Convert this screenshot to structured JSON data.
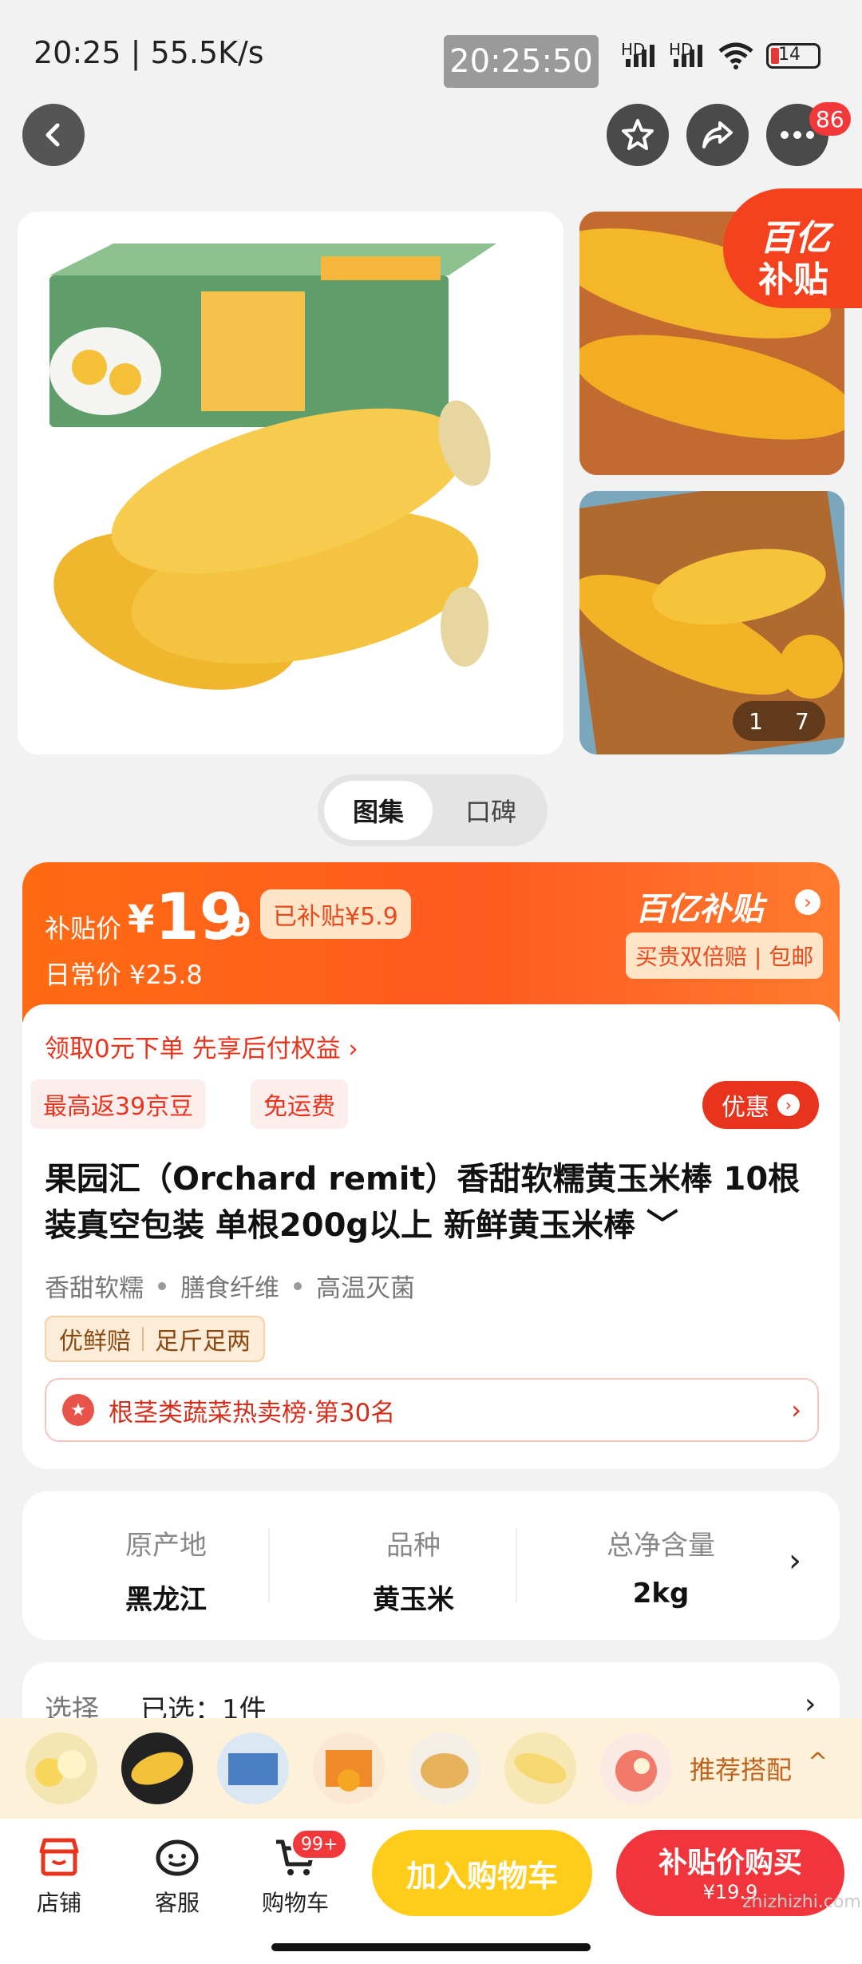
{
  "status_bar": {
    "time_speed": "20:25 | 55.5K/s",
    "clock_overlay": "20:25:50",
    "signal1": "HD",
    "signal2": "HD",
    "battery": "14"
  },
  "top_bar": {
    "more_badge": "86"
  },
  "gallery": {
    "subsidy_line1": "百亿",
    "subsidy_line2": "补贴",
    "counter_current": "1",
    "counter_total": "7"
  },
  "tabs": {
    "active": "图集",
    "inactive": "口碑"
  },
  "price": {
    "label": "补贴价",
    "currency": "¥",
    "integer": "19",
    "decimal": ".9",
    "subsidy_tag": "已补贴¥5.9",
    "daily_price": "日常价 ¥25.8",
    "brand": "百亿补贴",
    "guarantee": "买贵双倍赔 | 包邮"
  },
  "info": {
    "paylater": "领取0元下单 先享后付权益 ›",
    "tag_beans": "最高返39京豆",
    "tag_shipping": "免运费",
    "promo_button": "优惠",
    "title": "果园汇（Orchard remit）香甜软糯黄玉米棒 10根装真空包装 单根200g以上 新鲜黄玉米棒 ﹀",
    "features": [
      "香甜软糯",
      "膳食纤维",
      "高温灭菌"
    ],
    "fresh_tag_1": "优鲜赔",
    "fresh_tag_2": "足斤足两",
    "rank": "根茎类蔬菜热卖榜·第30名"
  },
  "attributes": [
    {
      "key": "原产地",
      "value": "黑龙江"
    },
    {
      "key": "品种",
      "value": "黄玉米"
    },
    {
      "key": "总净含量",
      "value": "2kg"
    }
  ],
  "selection": {
    "key": "选择",
    "value": "已选：1件"
  },
  "recommend": {
    "label": "推荐搭配"
  },
  "bottom_nav": {
    "store": "店铺",
    "service": "客服",
    "cart": "购物车",
    "cart_badge": "99+",
    "add_to_cart": "加入购物车",
    "buy_label": "补贴价购买",
    "buy_price": "¥19.9"
  },
  "watermark": "zhizhizhi.com"
}
